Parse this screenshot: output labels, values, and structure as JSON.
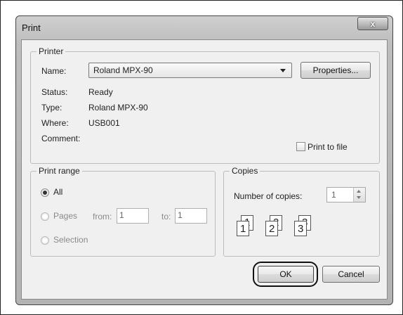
{
  "window": {
    "title": "Print",
    "close_label": "x"
  },
  "printer": {
    "group_label": "Printer",
    "name_label": "Name:",
    "name_value": "Roland MPX-90",
    "properties_label": "Properties...",
    "status_label": "Status:",
    "status_value": "Ready",
    "type_label": "Type:",
    "type_value": "Roland MPX-90",
    "where_label": "Where:",
    "where_value": "USB001",
    "comment_label": "Comment:",
    "print_to_file_label": "Print to file"
  },
  "print_range": {
    "group_label": "Print range",
    "all_label": "All",
    "pages_label": "Pages",
    "from_label": "from:",
    "from_value": "1",
    "to_label": "to:",
    "to_value": "1",
    "selection_label": "Selection",
    "selected": "All"
  },
  "copies": {
    "group_label": "Copies",
    "number_label": "Number of copies:",
    "number_value": "1",
    "collate_pages": [
      "1",
      "1",
      "2",
      "2",
      "3",
      "3"
    ]
  },
  "buttons": {
    "ok_label": "OK",
    "cancel_label": "Cancel"
  }
}
